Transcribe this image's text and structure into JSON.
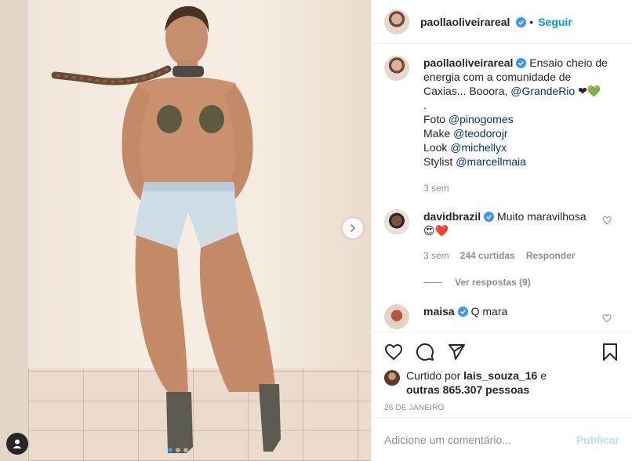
{
  "post": {
    "author": "paollaoliveirareal",
    "follow_label": "Seguir",
    "dot": "•",
    "caption": {
      "text1": "Ensaio cheio de energia com a comunidade de Caxias... Booora,",
      "mention_grande_rio": "@GrandeRio",
      "emoji": "❤💚",
      "line_dot": ".",
      "foto_label": "Foto",
      "foto_mention": "@pinogomes",
      "make_label": "Make",
      "make_mention": "@teodorojr",
      "look_label": "Look",
      "look_mention": "@michellyx",
      "stylist_label": "Stylist",
      "stylist_mention": "@marcellmaia",
      "time": "3 sem"
    },
    "comments": [
      {
        "user": "davidbrazil",
        "text": "Muito maravilhosa",
        "emoji": "😍❤️",
        "time": "3 sem",
        "likes": "244 curtidas",
        "reply_label": "Responder",
        "view_replies": "Ver respostas (9)"
      },
      {
        "user": "maisa",
        "text": "Q mara"
      }
    ],
    "likes": {
      "prefix": "Curtido por",
      "user": "lais_souza_16",
      "and": "e",
      "others": "outras 865.307 pessoas"
    },
    "date": "26 de janeiro",
    "add_comment_placeholder": "Adicione um comentário...",
    "publish_label": "Publicar"
  },
  "colors": {
    "accent": "#0095f6",
    "verified": "#3897f0",
    "mention": "#00376b",
    "muted": "#8e8e8e",
    "publish_disabled": "#b2dffc"
  },
  "carousel": {
    "slides": 3,
    "active_index": 0
  },
  "icons": [
    "verified-icon",
    "heart-icon",
    "comment-icon",
    "share-icon",
    "bookmark-icon",
    "chevron-right-icon",
    "user-tag-icon"
  ]
}
